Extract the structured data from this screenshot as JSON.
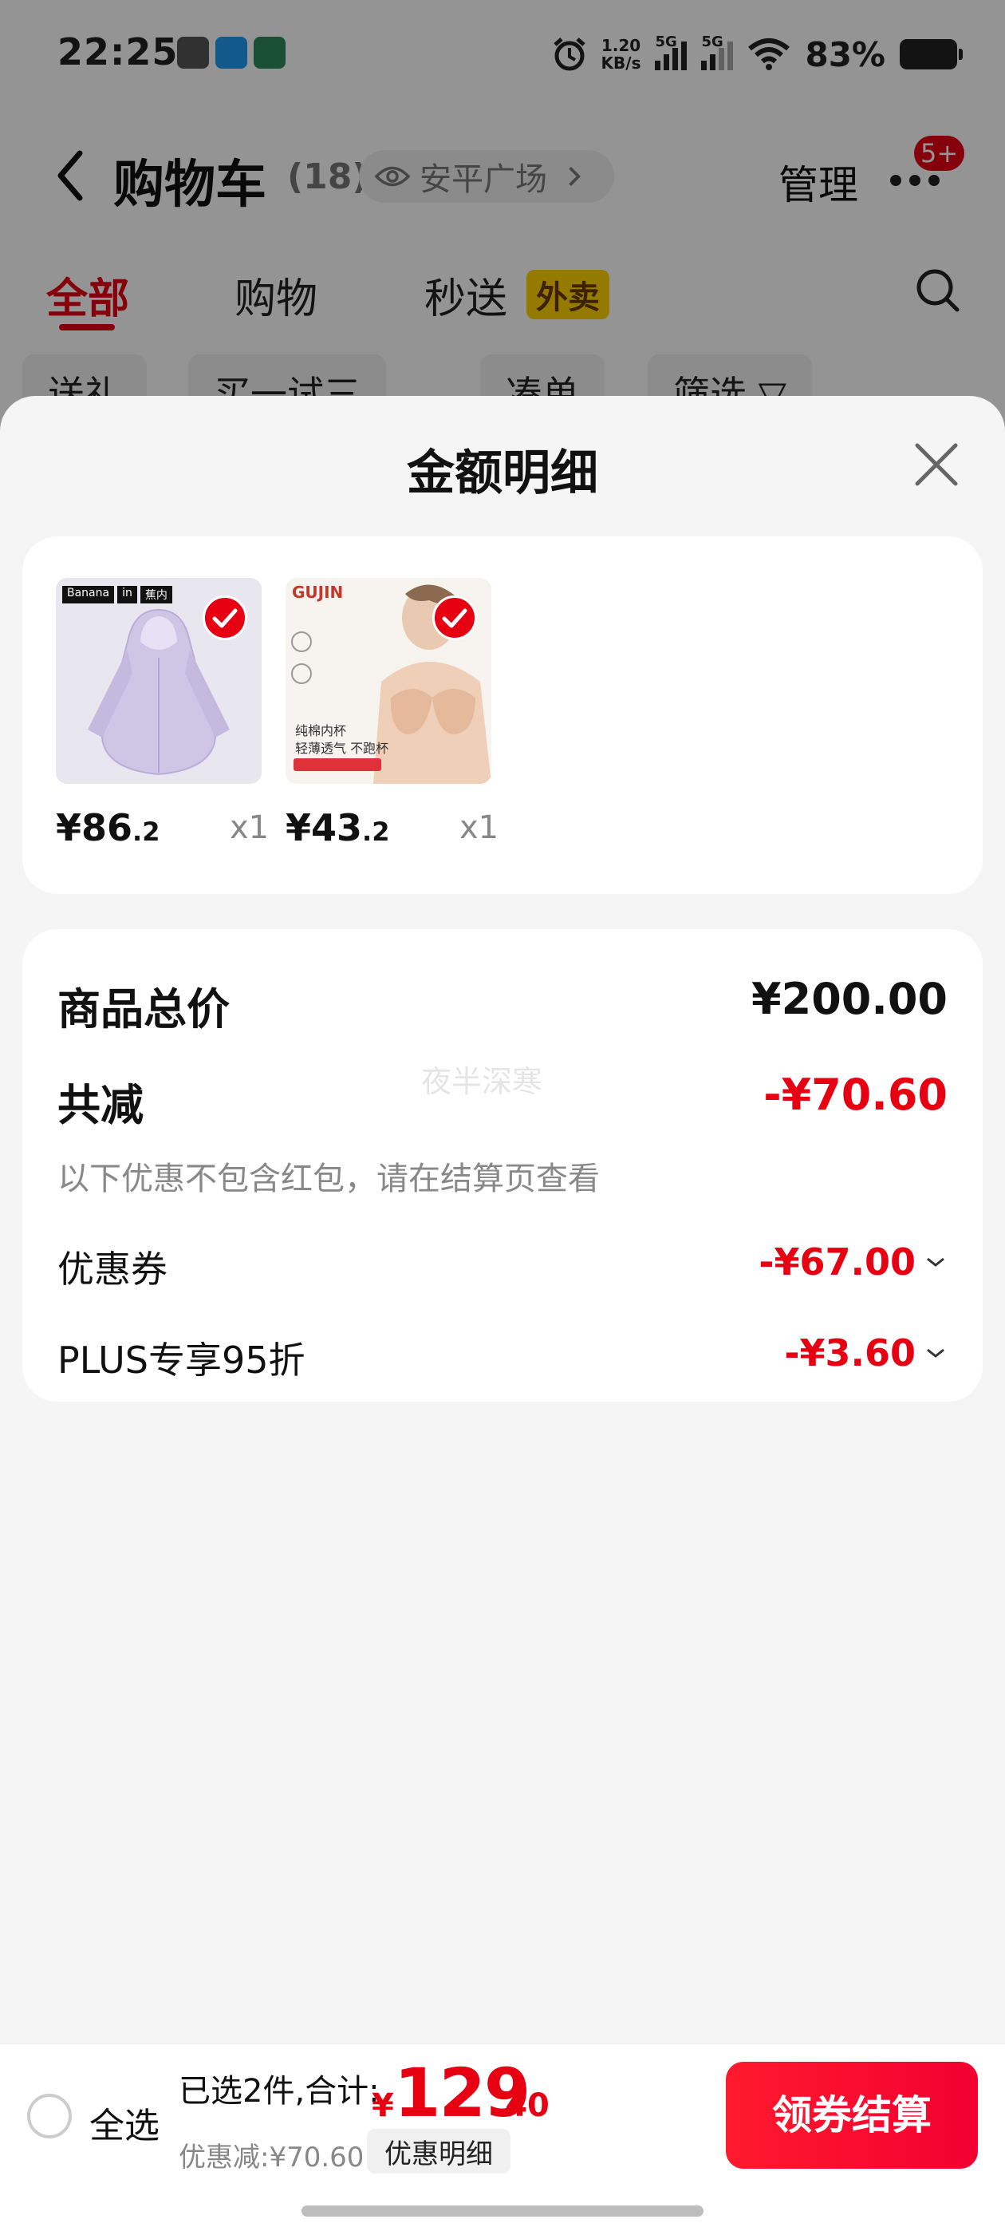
{
  "status_bar": {
    "time": "22:25",
    "net_speed_value": "1.20",
    "net_speed_unit": "KB/s",
    "signal_1_label": "5G",
    "signal_2_label": "5G",
    "battery_pct": "83%"
  },
  "cart_header": {
    "title": "购物车",
    "count": "(18)",
    "location": "安平广场",
    "manage": "管理",
    "badge": "5+"
  },
  "tabs": [
    {
      "label": "全部"
    },
    {
      "label": "购物"
    },
    {
      "label": "秒送"
    }
  ],
  "waimai_tag": "外卖",
  "filters": [
    {
      "label": "送礼"
    },
    {
      "label": "买一试三"
    },
    {
      "label": "凑单"
    },
    {
      "label": "筛选 ▽"
    }
  ],
  "sheet": {
    "title": "金额明细",
    "products": [
      {
        "price_int": "¥86",
        "price_dec": ".2",
        "qty": "x1",
        "image_labels": [
          "Banana",
          "in",
          "蕉内"
        ]
      },
      {
        "price_int": "¥43",
        "price_dec": ".2",
        "qty": "x1",
        "image_labels": [
          "GUJIN",
          "纯棉内杯",
          "轻薄透气 不跑杯"
        ]
      }
    ],
    "summary": {
      "total_label": "商品总价",
      "total_value": "¥200.00",
      "reduce_label": "共减",
      "reduce_value": "-¥70.60",
      "note": "以下优惠不包含红包，请在结算页查看",
      "watermark": "夜半深寒",
      "coupon_label": "优惠券",
      "coupon_value": "-¥67.00",
      "plus_label": "PLUS专享95折",
      "plus_value": "-¥3.60"
    }
  },
  "bottom_bar": {
    "select_all": "全选",
    "selected_summary": "已选2件,合计:",
    "total_currency": "¥",
    "total_int": "129",
    "total_dec": ".40",
    "discount": "优惠减:¥70.60",
    "detail_button": "优惠明细",
    "checkout_button": "领券结算"
  },
  "colors": {
    "accent_red": "#e60012",
    "sheet_bg": "#f5f5f5",
    "waimai_yellow": "#ffd400"
  }
}
